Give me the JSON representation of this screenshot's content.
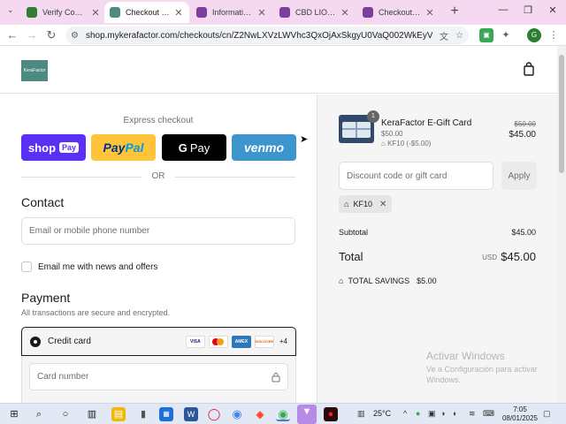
{
  "browser": {
    "tabs": [
      {
        "title": "Verify Codes — ",
        "favicon_color": "#2e7d32"
      },
      {
        "title": "Checkout - Kera",
        "favicon_color": "#4d8a80"
      },
      {
        "title": "Information - L",
        "favicon_color": "#7b3fa0"
      },
      {
        "title": "CBD LION - Sh",
        "favicon_color": "#7b3fa0"
      },
      {
        "title": "Checkout - Kel",
        "favicon_color": "#7b3fa0"
      }
    ],
    "active_tab": 1,
    "url": "shop.mykerafactor.com/checkouts/cn/Z2NwLXVzLWVhc3QxOjAxSkgyU0VaQ002WkEyVE5GQjEySk..."
  },
  "header": {
    "logo_text": "KeraFactor"
  },
  "checkout": {
    "express_title": "Express checkout",
    "pay_buttons": {
      "shop": "shop",
      "shop_pay": "Pay",
      "paypal_1": "Pay",
      "paypal_2": "Pal",
      "gpay_g": "G",
      "gpay": "Pay",
      "venmo": "venmo"
    },
    "or_label": "OR",
    "contact_title": "Contact",
    "contact_placeholder": "Email or mobile phone number",
    "newsletter_label": "Email me with news and offers",
    "payment_title": "Payment",
    "payment_subtitle": "All transactions are secure and encrypted.",
    "credit_card_label": "Credit card",
    "card_brands": [
      "VISA",
      "MC",
      "AMEX",
      "DISCOVER"
    ],
    "more_cards": "+4",
    "card_number_placeholder": "Card number"
  },
  "summary": {
    "item_quantity": "1",
    "item_name": "KeraFactor E-Gift Card",
    "item_unit_price": "$50.00",
    "item_discount": "KF10 (-$5.00)",
    "item_old_price": "$50.00",
    "item_new_price": "$45.00",
    "discount_placeholder": "Discount code or gift card",
    "apply_label": "Apply",
    "applied_code": "KF10",
    "subtotal_label": "Subtotal",
    "subtotal_value": "$45.00",
    "total_label": "Total",
    "total_currency": "USD",
    "total_value": "$45.00",
    "savings_label": "TOTAL SAVINGS",
    "savings_value": "$5.00"
  },
  "watermark": {
    "line1": "Activar Windows",
    "line2": "Ve a Configuración para activar",
    "line3": "Windows."
  },
  "taskbar": {
    "temperature": "25°C",
    "time": "7:05",
    "date": "08/01/2025"
  }
}
